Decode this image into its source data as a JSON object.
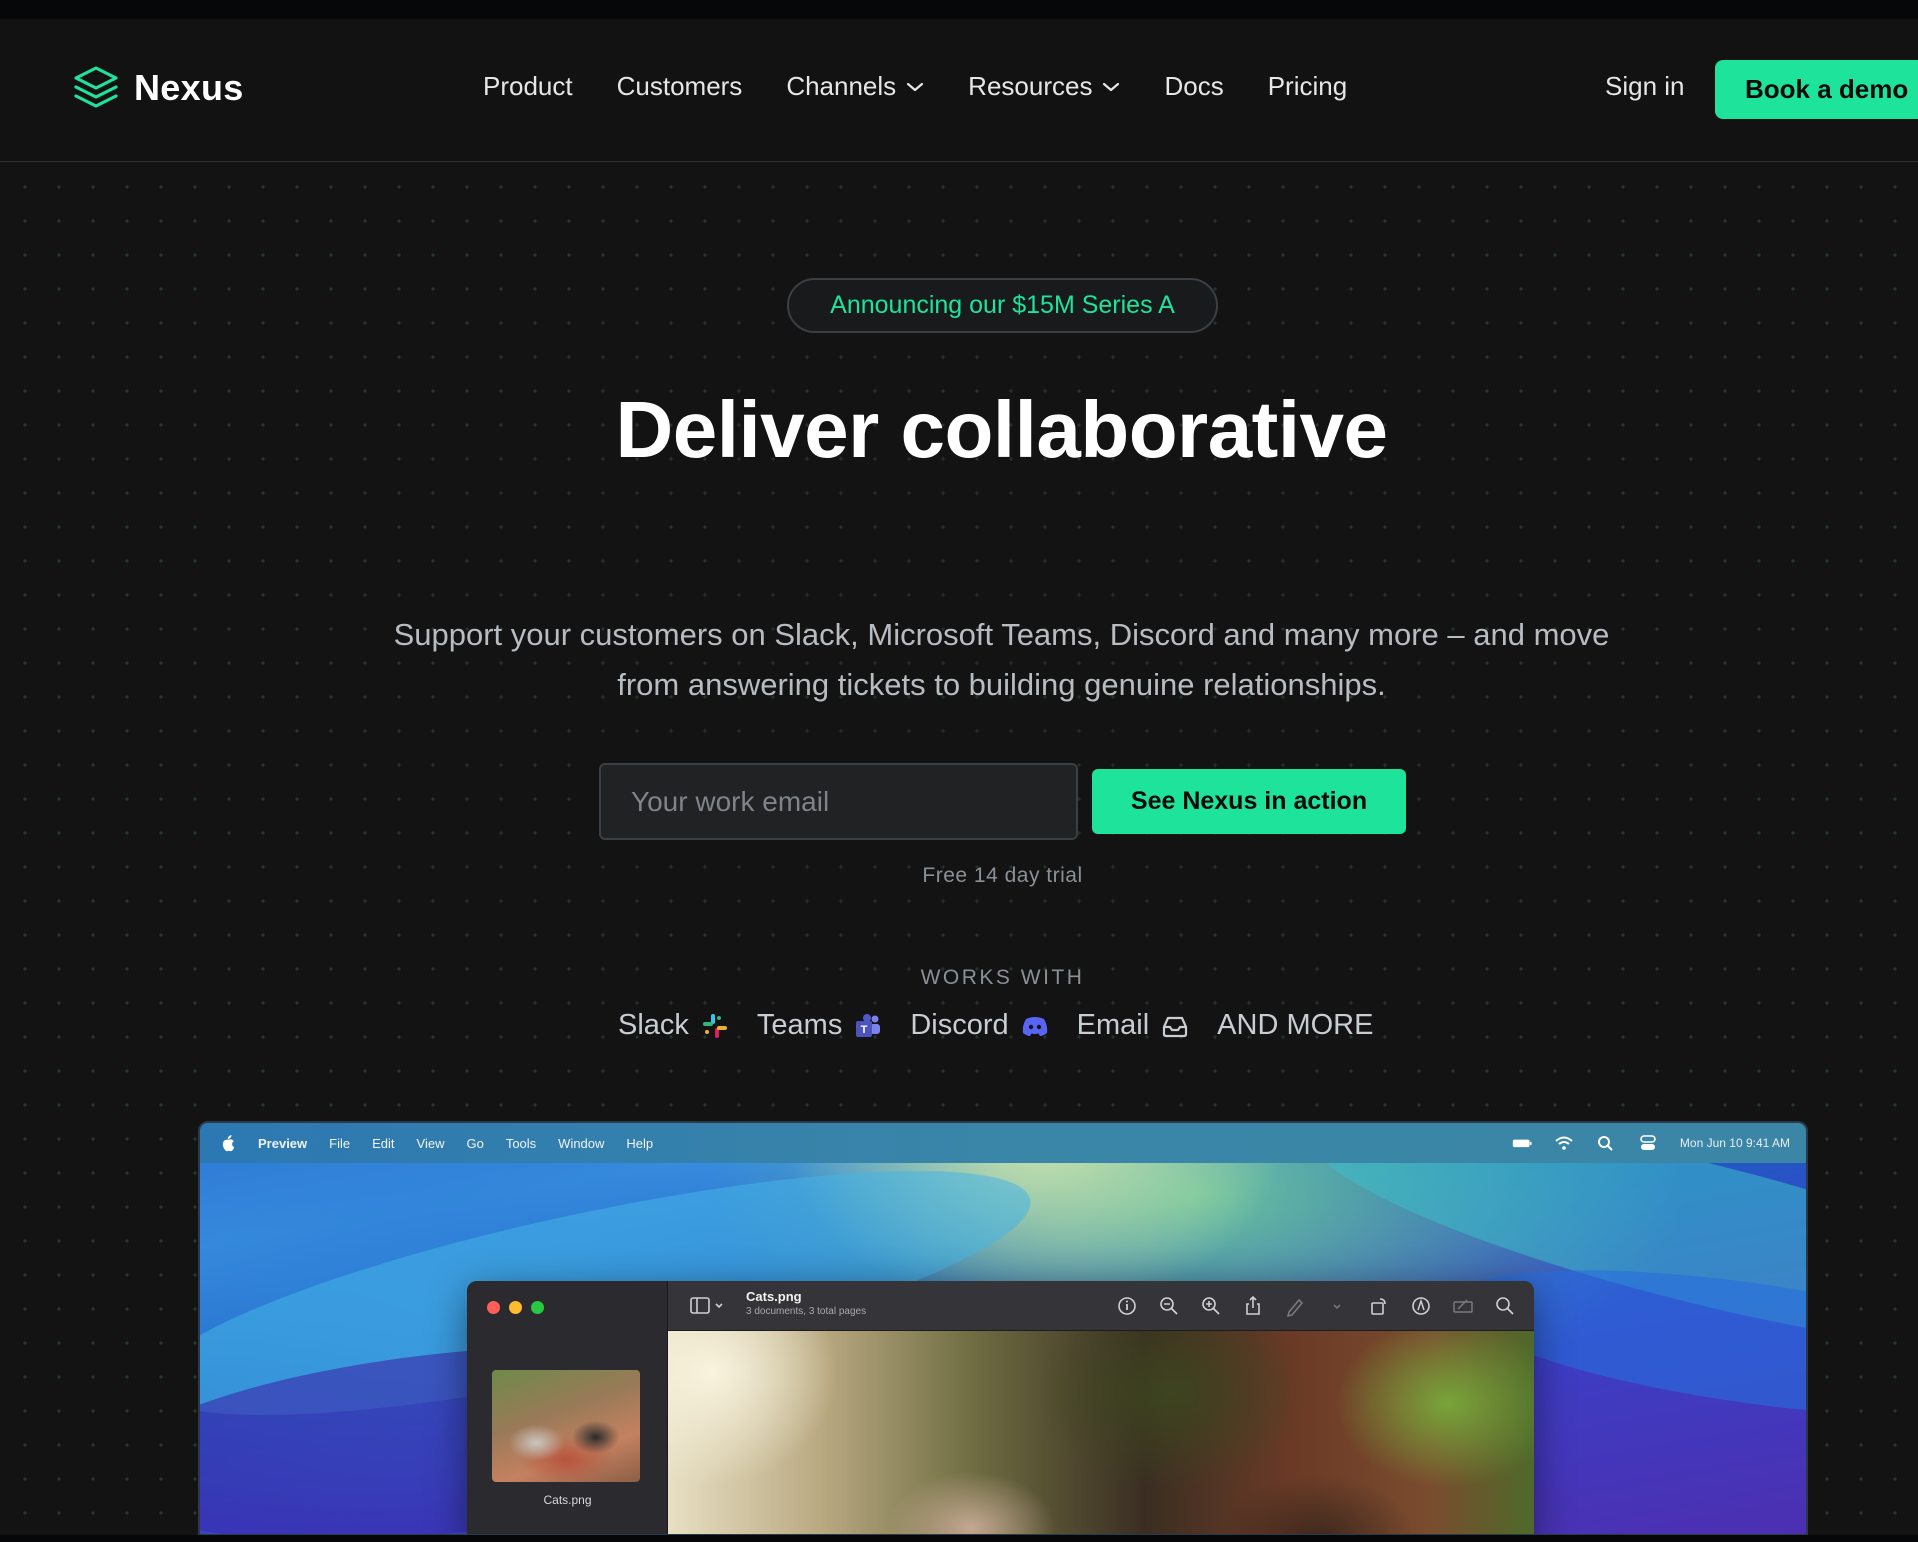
{
  "nav": {
    "brand": "Nexus",
    "links": [
      {
        "label": "Product",
        "dropdown": false
      },
      {
        "label": "Customers",
        "dropdown": false
      },
      {
        "label": "Channels",
        "dropdown": true
      },
      {
        "label": "Resources",
        "dropdown": true
      },
      {
        "label": "Docs",
        "dropdown": false
      },
      {
        "label": "Pricing",
        "dropdown": false
      }
    ],
    "sign_in": "Sign in",
    "book_demo": "Book a demo"
  },
  "hero": {
    "announcement": "Announcing our $15M Series A",
    "headline": "Deliver collaborative",
    "subtext": "Support your customers on Slack, Microsoft Teams, Discord and many more – and move from answering tickets to building genuine relationships.",
    "email_placeholder": "Your work email",
    "cta": "See Nexus in action",
    "trial_note": "Free 14 day trial",
    "works_with_label": "WORKS WITH",
    "channels": [
      {
        "label": "Slack",
        "icon": "slack-icon"
      },
      {
        "label": "Teams",
        "icon": "teams-icon"
      },
      {
        "label": "Discord",
        "icon": "discord-icon"
      },
      {
        "label": "Email",
        "icon": "inbox-icon"
      },
      {
        "label": "AND MORE"
      }
    ]
  },
  "screenshot": {
    "menubar": {
      "app": "Preview",
      "items": [
        "File",
        "Edit",
        "View",
        "Go",
        "Tools",
        "Window",
        "Help"
      ],
      "clock": "Mon Jun 10  9:41 AM"
    },
    "preview": {
      "title": "Cats.png",
      "subtitle": "3 documents, 3 total pages",
      "thumb_label": "Cats.png"
    }
  },
  "colors": {
    "accent": "#1ee39b",
    "background": "#131313",
    "nav_background": "#121212"
  }
}
